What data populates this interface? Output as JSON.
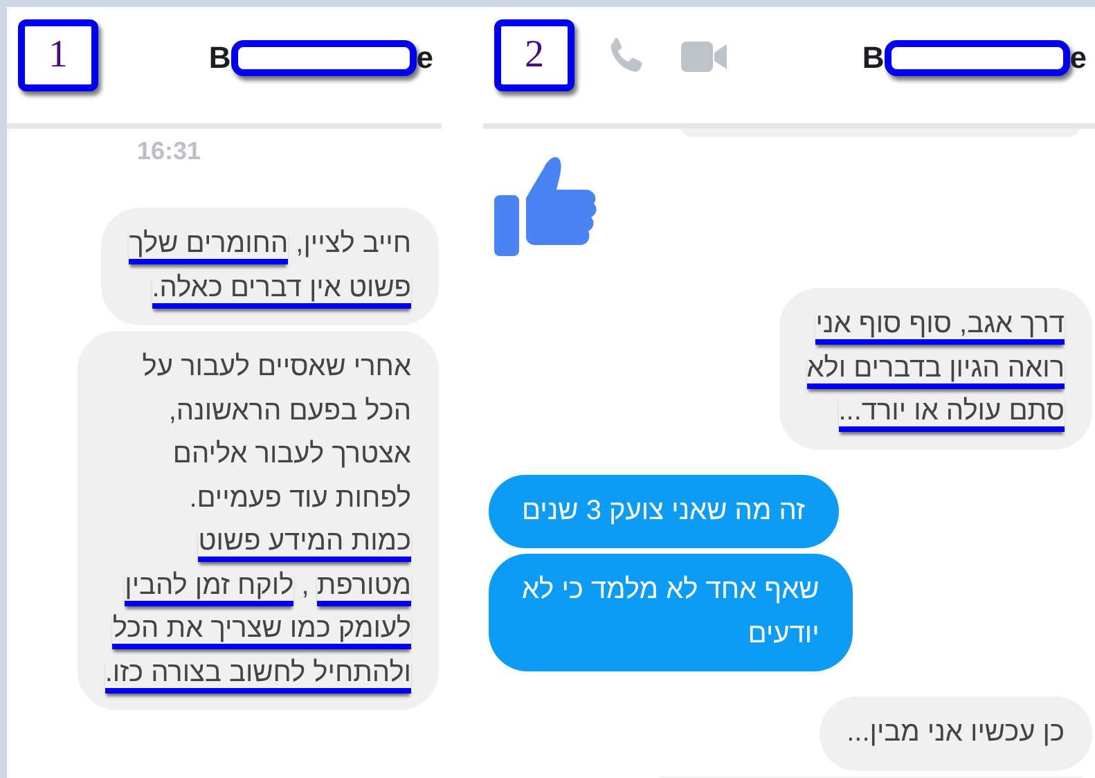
{
  "left_panel": {
    "badge": "1",
    "name": {
      "first_letter": "B",
      "last_letter": "e"
    },
    "call_buttons": false,
    "timestamp": "16:31",
    "messages": [
      {
        "kind": "grey",
        "lines": [
          {
            "parts": [
              {
                "text": "חייב לציין, ",
                "underlined": false
              },
              {
                "text": "החומרים שלך",
                "underlined": true
              }
            ]
          },
          {
            "parts": [
              {
                "text": "פשוט אין דברים כאלה.",
                "underlined": true
              }
            ]
          }
        ]
      },
      {
        "kind": "grey",
        "lines": [
          {
            "parts": [
              {
                "text": "אחרי שאסיים לעבור על",
                "underlined": false
              }
            ]
          },
          {
            "parts": [
              {
                "text": "הכל בפעם הראשונה,",
                "underlined": false
              }
            ]
          },
          {
            "parts": [
              {
                "text": "אצטרך לעבור אליהם",
                "underlined": false
              }
            ]
          },
          {
            "parts": [
              {
                "text": "לפחות עוד פעמיים.",
                "underlined": false
              }
            ]
          },
          {
            "parts": [
              {
                "text": "כמות המידע פשוט",
                "underlined": true
              }
            ]
          },
          {
            "parts": [
              {
                "text": "מטורפת",
                "underlined": true
              },
              {
                "text": " , ",
                "underlined": false
              },
              {
                "text": "לוקח זמן להבין",
                "underlined": true
              }
            ]
          },
          {
            "parts": [
              {
                "text": "לעומק כמו שצריך את הכל",
                "underlined": true
              }
            ]
          },
          {
            "parts": [
              {
                "text": "ולהתחיל לחשוב בצורה כזו.",
                "underlined": true
              }
            ]
          }
        ]
      }
    ]
  },
  "right_panel": {
    "badge": "2",
    "name": {
      "first_letter": "B",
      "last_letter": "e"
    },
    "call_buttons": true,
    "messages": [
      {
        "kind": "cut-top"
      },
      {
        "kind": "like"
      },
      {
        "kind": "grey",
        "lines": [
          {
            "parts": [
              {
                "text": "דרך אגב, סוף סוף אני",
                "underlined": true
              }
            ]
          },
          {
            "parts": [
              {
                "text": "רואה הגיון בדברים ולא",
                "underlined": true
              }
            ]
          },
          {
            "parts": [
              {
                "text": "סתם עולה או יורד...",
                "underlined": true
              }
            ]
          }
        ]
      },
      {
        "kind": "blue",
        "lines": [
          {
            "parts": [
              {
                "text": "זה מה שאני צועק 3 שנים",
                "underlined": false
              }
            ]
          }
        ]
      },
      {
        "kind": "blue",
        "lines": [
          {
            "parts": [
              {
                "text": "שאף אחד לא מלמד כי לא",
                "underlined": false
              }
            ]
          },
          {
            "parts": [
              {
                "text": "יודעים",
                "underlined": false
              }
            ]
          }
        ]
      },
      {
        "kind": "grey",
        "lines": [
          {
            "parts": [
              {
                "text": "כן עכשיו אני מבין...",
                "underlined": false
              }
            ]
          }
        ]
      },
      {
        "kind": "cut-bottom"
      }
    ]
  }
}
